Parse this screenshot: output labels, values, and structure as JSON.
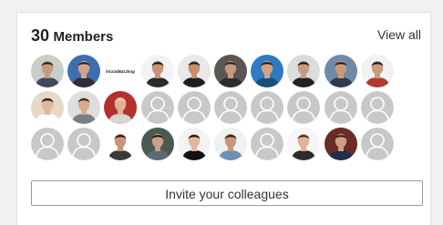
{
  "header": {
    "member_count": "30",
    "member_label": "Members",
    "view_all_label": "View all"
  },
  "invite_button_label": "Invite your colleagues",
  "avatar_mini_text": "hirzadBat.blog",
  "members": [
    {
      "type": "photo",
      "bg": "#c9cfc7",
      "skin": "#c69a7e",
      "hair": "#2b2118",
      "shirt": "#3d4a5c"
    },
    {
      "type": "photo",
      "bg": "#3d6fb0",
      "skin": "#d2a586",
      "hair": "#2a1f18",
      "shirt": "#2f2f35"
    },
    {
      "type": "text",
      "bg": "#ffffff"
    },
    {
      "type": "photo",
      "bg": "#f3f3f3",
      "skin": "#c89474",
      "hair": "#1c1612",
      "shirt": "#2b2b2b"
    },
    {
      "type": "photo",
      "bg": "#e9e9e9",
      "skin": "#c58f6f",
      "hair": "#231b15",
      "shirt": "#1f1f23"
    },
    {
      "type": "photo",
      "bg": "#5a5652",
      "skin": "#c69a7e",
      "hair": "#2a2420",
      "shirt": "#2e2e30"
    },
    {
      "type": "photo",
      "bg": "#2d7bc2",
      "skin": "#d3a185",
      "hair": "#241a12",
      "shirt": "#1b4f7a"
    },
    {
      "type": "photo",
      "bg": "#dcdcdc",
      "skin": "#c89a7c",
      "hair": "#1a1410",
      "shirt": "#222222"
    },
    {
      "type": "photo",
      "bg": "#6f8aa8",
      "skin": "#c99a7a",
      "hair": "#261d17",
      "shirt": "#2f3b4a"
    },
    {
      "type": "photo",
      "bg": "#f2f2f2",
      "skin": "#cc9b7d",
      "hair": "#1f1712",
      "shirt": "#b23a2e"
    },
    {
      "type": "photo",
      "bg": "#e7d9c9",
      "skin": "#e0b89b",
      "hair": "#1d1611",
      "shirt": "#ffffff"
    },
    {
      "type": "photo",
      "bg": "#dedede",
      "skin": "#d8ab8e",
      "hair": "#3a2a20",
      "shirt": "#7a7d84"
    },
    {
      "type": "photo",
      "bg": "#b3302c",
      "skin": "#dfb093",
      "hair": "#e8d3c4",
      "shirt": "#d6d6d6"
    },
    {
      "type": "placeholder"
    },
    {
      "type": "placeholder"
    },
    {
      "type": "placeholder"
    },
    {
      "type": "placeholder"
    },
    {
      "type": "placeholder"
    },
    {
      "type": "placeholder"
    },
    {
      "type": "placeholder"
    },
    {
      "type": "placeholder"
    },
    {
      "type": "placeholder"
    },
    {
      "type": "photo",
      "bg": "#ffffff",
      "skin": "#c99477",
      "hair": "#231a14",
      "shirt": "#3a3a3a"
    },
    {
      "type": "photo",
      "bg": "#4a5a52",
      "skin": "#c9a085",
      "hair": "#1e1813",
      "shirt": "#5b6a74"
    },
    {
      "type": "photo",
      "bg": "#f3f3f3",
      "skin": "#e2b89c",
      "hair": "#111111",
      "shirt": "#111111"
    },
    {
      "type": "photo",
      "bg": "#f1f1f1",
      "skin": "#c8977a",
      "hair": "#2a1e16",
      "shirt": "#6f8fb0"
    },
    {
      "type": "placeholder"
    },
    {
      "type": "photo",
      "bg": "#f6f6f6",
      "skin": "#e0b296",
      "hair": "#3a2a20",
      "shirt": "#2c2c2c"
    },
    {
      "type": "photo",
      "bg": "#6a2c26",
      "skin": "#cf9e80",
      "hair": "#2b211a",
      "shirt": "#1f2f4a"
    },
    {
      "type": "placeholder"
    }
  ]
}
